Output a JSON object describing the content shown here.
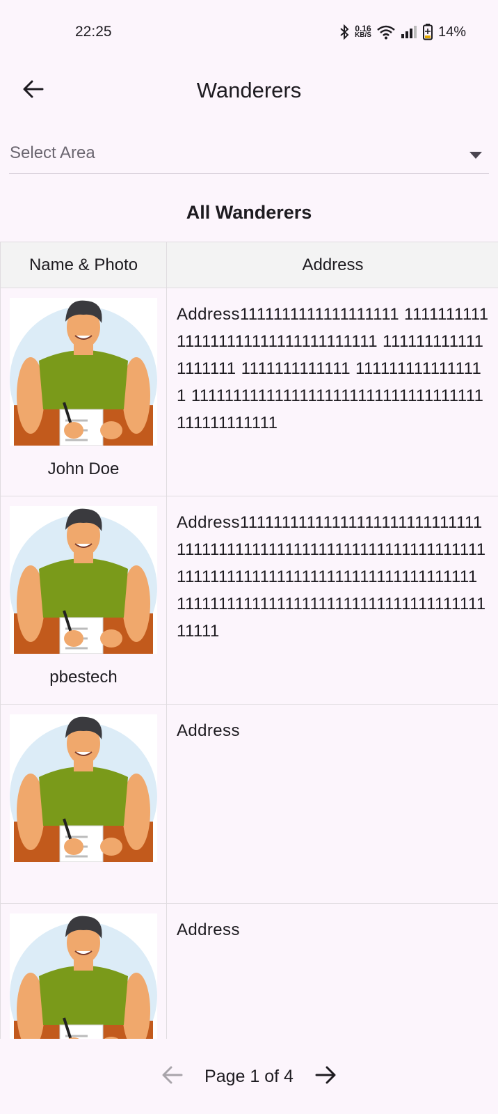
{
  "status_bar": {
    "time": "22:25",
    "net_speed_value": "0.16",
    "net_speed_unit": "KB/S",
    "battery": "14%"
  },
  "app_bar": {
    "title": "Wanderers",
    "back_icon": "arrow-left-icon"
  },
  "filter": {
    "placeholder": "Select Area",
    "caret_icon": "dropdown-caret-icon"
  },
  "section_title": "All Wanderers",
  "table": {
    "headers": [
      "Name & Photo",
      "Address"
    ],
    "rows": [
      {
        "name": "John Doe",
        "address": "Address1111111111111111111 1111111111111111111111111111111111 1111111111111111111 1111111111111 1111111111111111 11111111111111111111111111111111111111111111111"
      },
      {
        "name": "pbestech",
        "address": "Address111111111111111111111111111111111111111111111111111111111111111111111111111111111111111111111111111111 111111111111111111111111111111111111111111"
      },
      {
        "name": "",
        "address": "Address"
      },
      {
        "name": "",
        "address": "Address"
      }
    ]
  },
  "pager": {
    "label": "Page 1 of 4",
    "prev_icon": "arrow-left-icon",
    "next_icon": "arrow-right-icon"
  },
  "colors": {
    "background": "#fcf5fc",
    "header_bg": "#f3f3f3",
    "shirt": "#7a9a1a",
    "desk": "#c25a1c",
    "circle": "#dcecf7",
    "skin": "#f0a86c"
  }
}
